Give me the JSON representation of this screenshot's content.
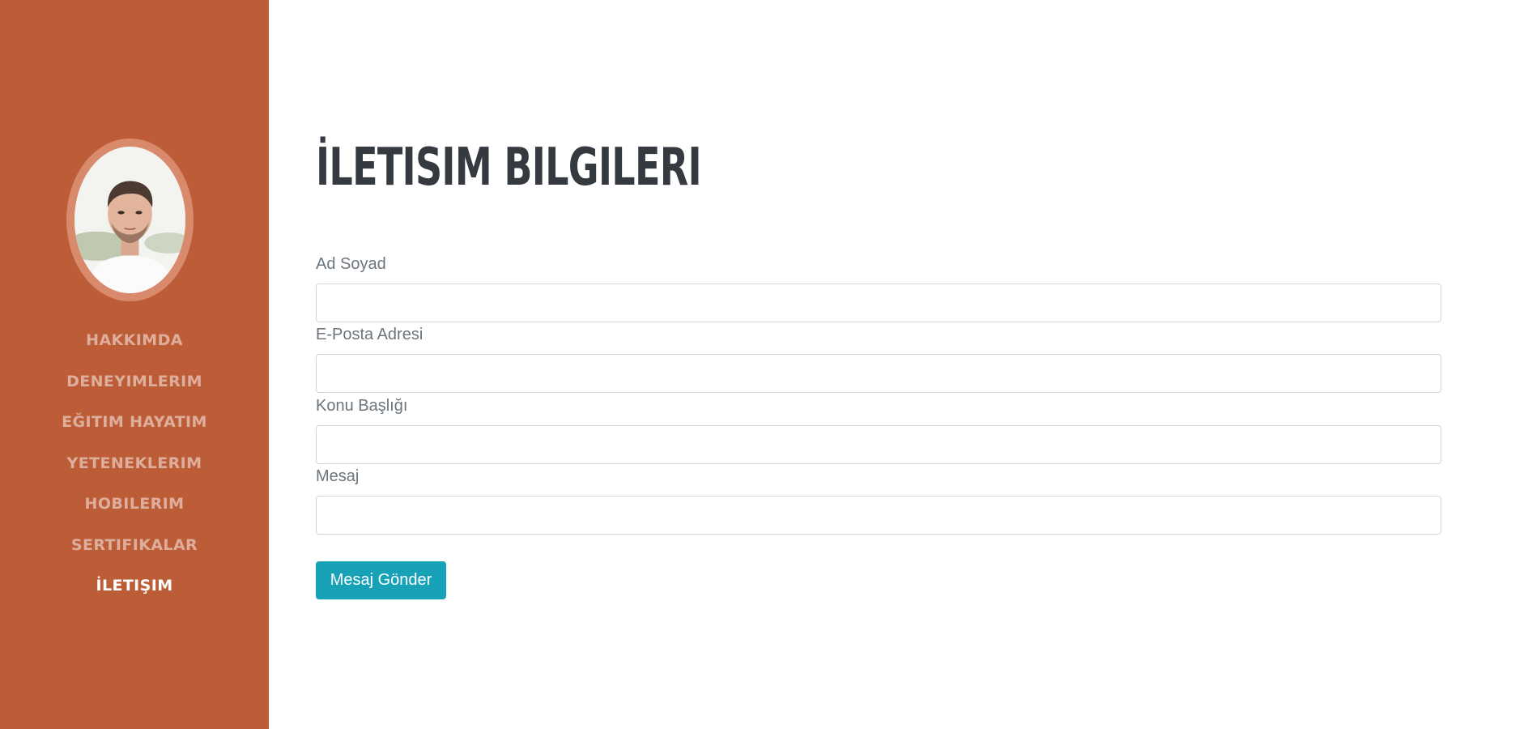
{
  "sidebar": {
    "colors": {
      "background": "#bd5d38",
      "avatar_ring": "#d98a6c"
    },
    "nav": [
      {
        "label": "HAKKIMDA"
      },
      {
        "label": "DENEYIMLERIM"
      },
      {
        "label": "EĞITIM HAYATIM"
      },
      {
        "label": "YETENEKLERIM"
      },
      {
        "label": "HOBILERIM"
      },
      {
        "label": "SERTIFIKALAR"
      },
      {
        "label": "İLETIŞIM",
        "active": true
      }
    ]
  },
  "main": {
    "title": "İLETISIM BILGILERI",
    "form": {
      "fields": [
        {
          "label": "Ad Soyad",
          "value": ""
        },
        {
          "label": "E-Posta Adresi",
          "value": ""
        },
        {
          "label": "Konu Başlığı",
          "value": ""
        },
        {
          "label": "Mesaj",
          "value": ""
        }
      ],
      "submit_label": "Mesaj Gönder",
      "submit_color": "#17a2b8"
    }
  }
}
